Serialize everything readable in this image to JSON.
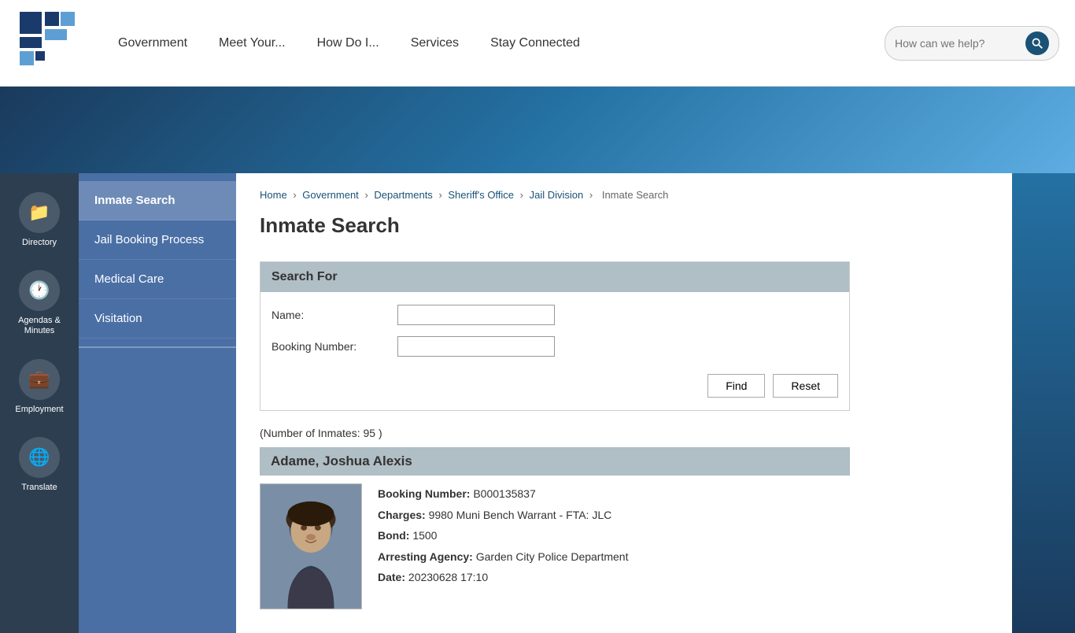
{
  "header": {
    "search_placeholder": "How can we help?",
    "nav_items": [
      {
        "label": "Government",
        "id": "government"
      },
      {
        "label": "Meet Your...",
        "id": "meet-your"
      },
      {
        "label": "How Do I...",
        "id": "how-do-i"
      },
      {
        "label": "Services",
        "id": "services"
      },
      {
        "label": "Stay Connected",
        "id": "stay-connected"
      }
    ]
  },
  "sidebar_icons": [
    {
      "label": "Directory",
      "icon": "📁",
      "id": "directory"
    },
    {
      "label": "Agendas & Minutes",
      "icon": "🕐",
      "id": "agendas-minutes"
    },
    {
      "label": "Employment",
      "icon": "💼",
      "id": "employment"
    },
    {
      "label": "Translate",
      "icon": "🌐",
      "id": "translate"
    }
  ],
  "left_nav": {
    "items": [
      {
        "label": "Inmate Search",
        "id": "inmate-search",
        "active": true
      },
      {
        "label": "Jail Booking Process",
        "id": "jail-booking"
      },
      {
        "label": "Medical Care",
        "id": "medical-care"
      },
      {
        "label": "Visitation",
        "id": "visitation"
      }
    ]
  },
  "breadcrumb": {
    "items": [
      {
        "label": "Home",
        "href": "#"
      },
      {
        "label": "Government",
        "href": "#"
      },
      {
        "label": "Departments",
        "href": "#"
      },
      {
        "label": "Sheriff's Office",
        "href": "#"
      },
      {
        "label": "Jail Division",
        "href": "#"
      },
      {
        "label": "Inmate Search",
        "href": null
      }
    ]
  },
  "page_title": "Inmate Search",
  "search_form": {
    "header": "Search For",
    "name_label": "Name:",
    "booking_label": "Booking Number:",
    "find_btn": "Find",
    "reset_btn": "Reset"
  },
  "inmates_count": "(Number of Inmates: 95 )",
  "inmate": {
    "name": "Adame, Joshua Alexis",
    "booking_number_label": "Booking Number:",
    "booking_number": "B000135837",
    "charges_label": "Charges:",
    "charges": "9980 Muni Bench Warrant - FTA: JLC",
    "bond_label": "Bond:",
    "bond": "1500",
    "arresting_agency_label": "Arresting Agency:",
    "arresting_agency": "Garden City Police Department",
    "date_label": "Date:",
    "date": "20230628 17:10"
  }
}
